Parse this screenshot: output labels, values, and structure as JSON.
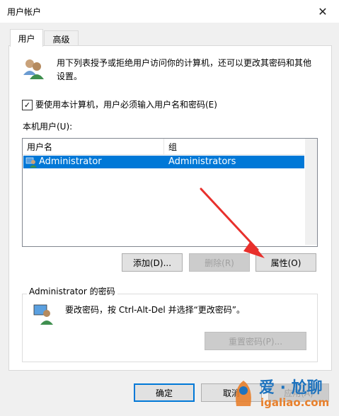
{
  "window": {
    "title": "用户帐户",
    "close_glyph": "✕"
  },
  "tabs": [
    {
      "label": "用户"
    },
    {
      "label": "高级"
    }
  ],
  "intro_text": "用下列表授予或拒绝用户访问你的计算机，还可以更改其密码和其他设置。",
  "checkbox": {
    "label": "要使用本计算机，用户必须输入用户名和密码(E)",
    "checked": true,
    "glyph": "✓"
  },
  "local_users_label": "本机用户(U):",
  "users_table": {
    "columns": [
      "用户名",
      "组"
    ],
    "rows": [
      {
        "name": "Administrator",
        "group": "Administrators",
        "selected": true
      }
    ]
  },
  "buttons": {
    "add": "添加(D)...",
    "remove": "删除(R)",
    "properties": "属性(O)"
  },
  "password_group": {
    "title": "Administrator 的密码",
    "text": "要改密码，按 Ctrl-Alt-Del 并选择“更改密码”。",
    "reset_button": "重置密码(P)..."
  },
  "footer": {
    "ok": "确定",
    "cancel": "取消",
    "apply": "应用(A)"
  },
  "watermark": {
    "cn": "爱 · 尬聊",
    "url": "igaliao.com"
  },
  "colors": {
    "selection": "#0078d7",
    "annotation_arrow": "#e8302c",
    "watermark_blue": "#1e73be",
    "watermark_orange": "#e8802c"
  }
}
